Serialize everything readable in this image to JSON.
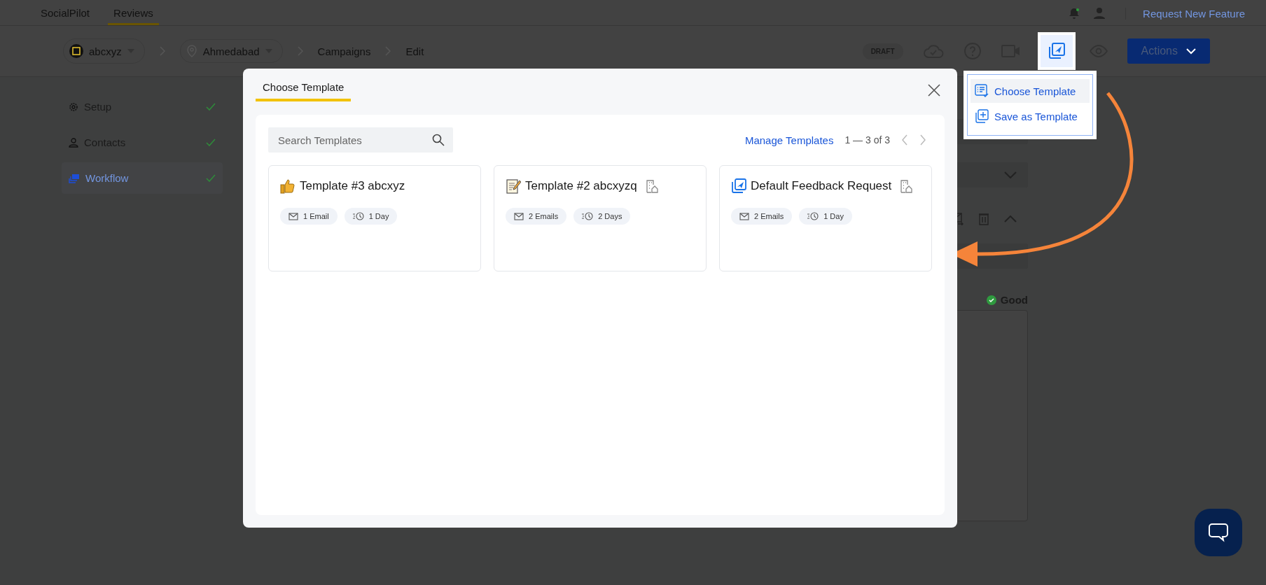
{
  "top_nav": {
    "tabs": [
      {
        "label": "SocialPilot",
        "selected": false
      },
      {
        "label": "Reviews",
        "selected": true
      }
    ],
    "link": "Request New Feature"
  },
  "breadcrumb": [
    {
      "kind": "account",
      "label": "abcxyz"
    },
    {
      "kind": "location",
      "label": "Ahmedabad"
    },
    {
      "kind": "text",
      "label": "Campaigns"
    },
    {
      "kind": "current",
      "label": "Edit"
    }
  ],
  "status_badge": "DRAFT",
  "actions_button": "Actions",
  "template_menu": [
    {
      "kind": "choose",
      "label": "Choose Template",
      "selected": true
    },
    {
      "kind": "save",
      "label": "Save as Template",
      "selected": false
    }
  ],
  "sidebar": [
    {
      "kind": "setup",
      "label": "Setup",
      "selected": false,
      "done": true
    },
    {
      "kind": "contacts",
      "label": "Contacts",
      "selected": false,
      "done": true
    },
    {
      "kind": "workflow",
      "label": "Workflow",
      "selected": true,
      "done": true
    }
  ],
  "editor": {
    "quality": "Good"
  },
  "modal": {
    "tab": {
      "label": "Choose Template",
      "selected": true
    },
    "search": {
      "placeholder": "Search Templates"
    },
    "manage_link": "Manage Templates",
    "pagination": "1 — 3 of 3",
    "templates": [
      {
        "kind": "thumbs",
        "name": "Template #3 abcxyz",
        "shared": false,
        "emails": "1 Email",
        "delay": "1 Day"
      },
      {
        "kind": "memo",
        "name": "Template #2 abcxyzq",
        "shared": true,
        "emails": "2 Emails",
        "delay": "2 Days"
      },
      {
        "kind": "send",
        "name": "Default Feedback Request",
        "shared": true,
        "emails": "2 Emails",
        "delay": "1 Day"
      }
    ]
  }
}
